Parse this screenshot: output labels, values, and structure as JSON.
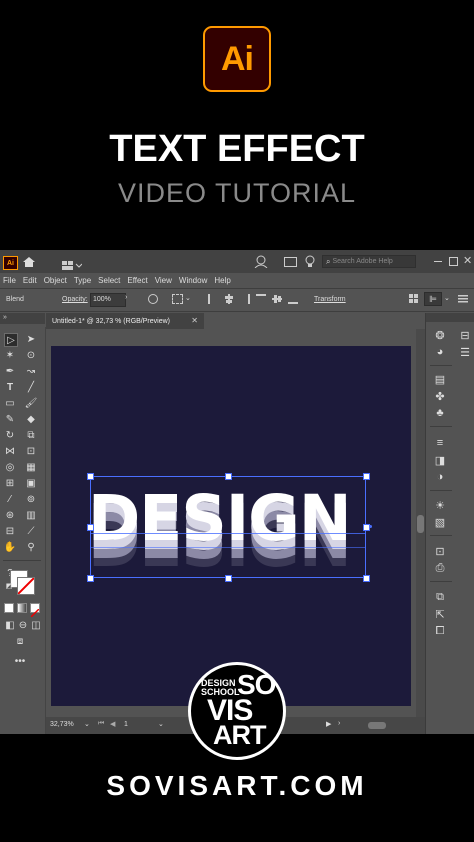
{
  "header": {
    "app_logo_text": "Ai",
    "title": "TEXT EFFECT",
    "subtitle": "VIDEO TUTORIAL"
  },
  "app": {
    "logo_text": "Ai",
    "search_placeholder": "Search Adobe Help",
    "menu": [
      "File",
      "Edit",
      "Object",
      "Type",
      "Select",
      "Effect",
      "View",
      "Window",
      "Help"
    ],
    "control": {
      "blend_label": "Blend",
      "opacity_label": "Opacity:",
      "opacity_value": "100%",
      "transform_label": "Transform"
    },
    "document_tab": "Untitled-1* @ 32,73 % (RGB/Preview)",
    "artboard_text": "DESIGN",
    "status": {
      "zoom": "32,73%",
      "artboard_number": "1"
    }
  },
  "brand": {
    "logo_lines": [
      "DESIGN",
      "SCHOOL",
      "SO",
      "VIS",
      "ART"
    ],
    "url": "SOVISART.COM"
  },
  "colors": {
    "ai_orange": "#ff9a00",
    "ai_bg": "#330000",
    "artboard": "#1c1a3a",
    "selection": "#4a6fff",
    "panel": "#535353"
  }
}
